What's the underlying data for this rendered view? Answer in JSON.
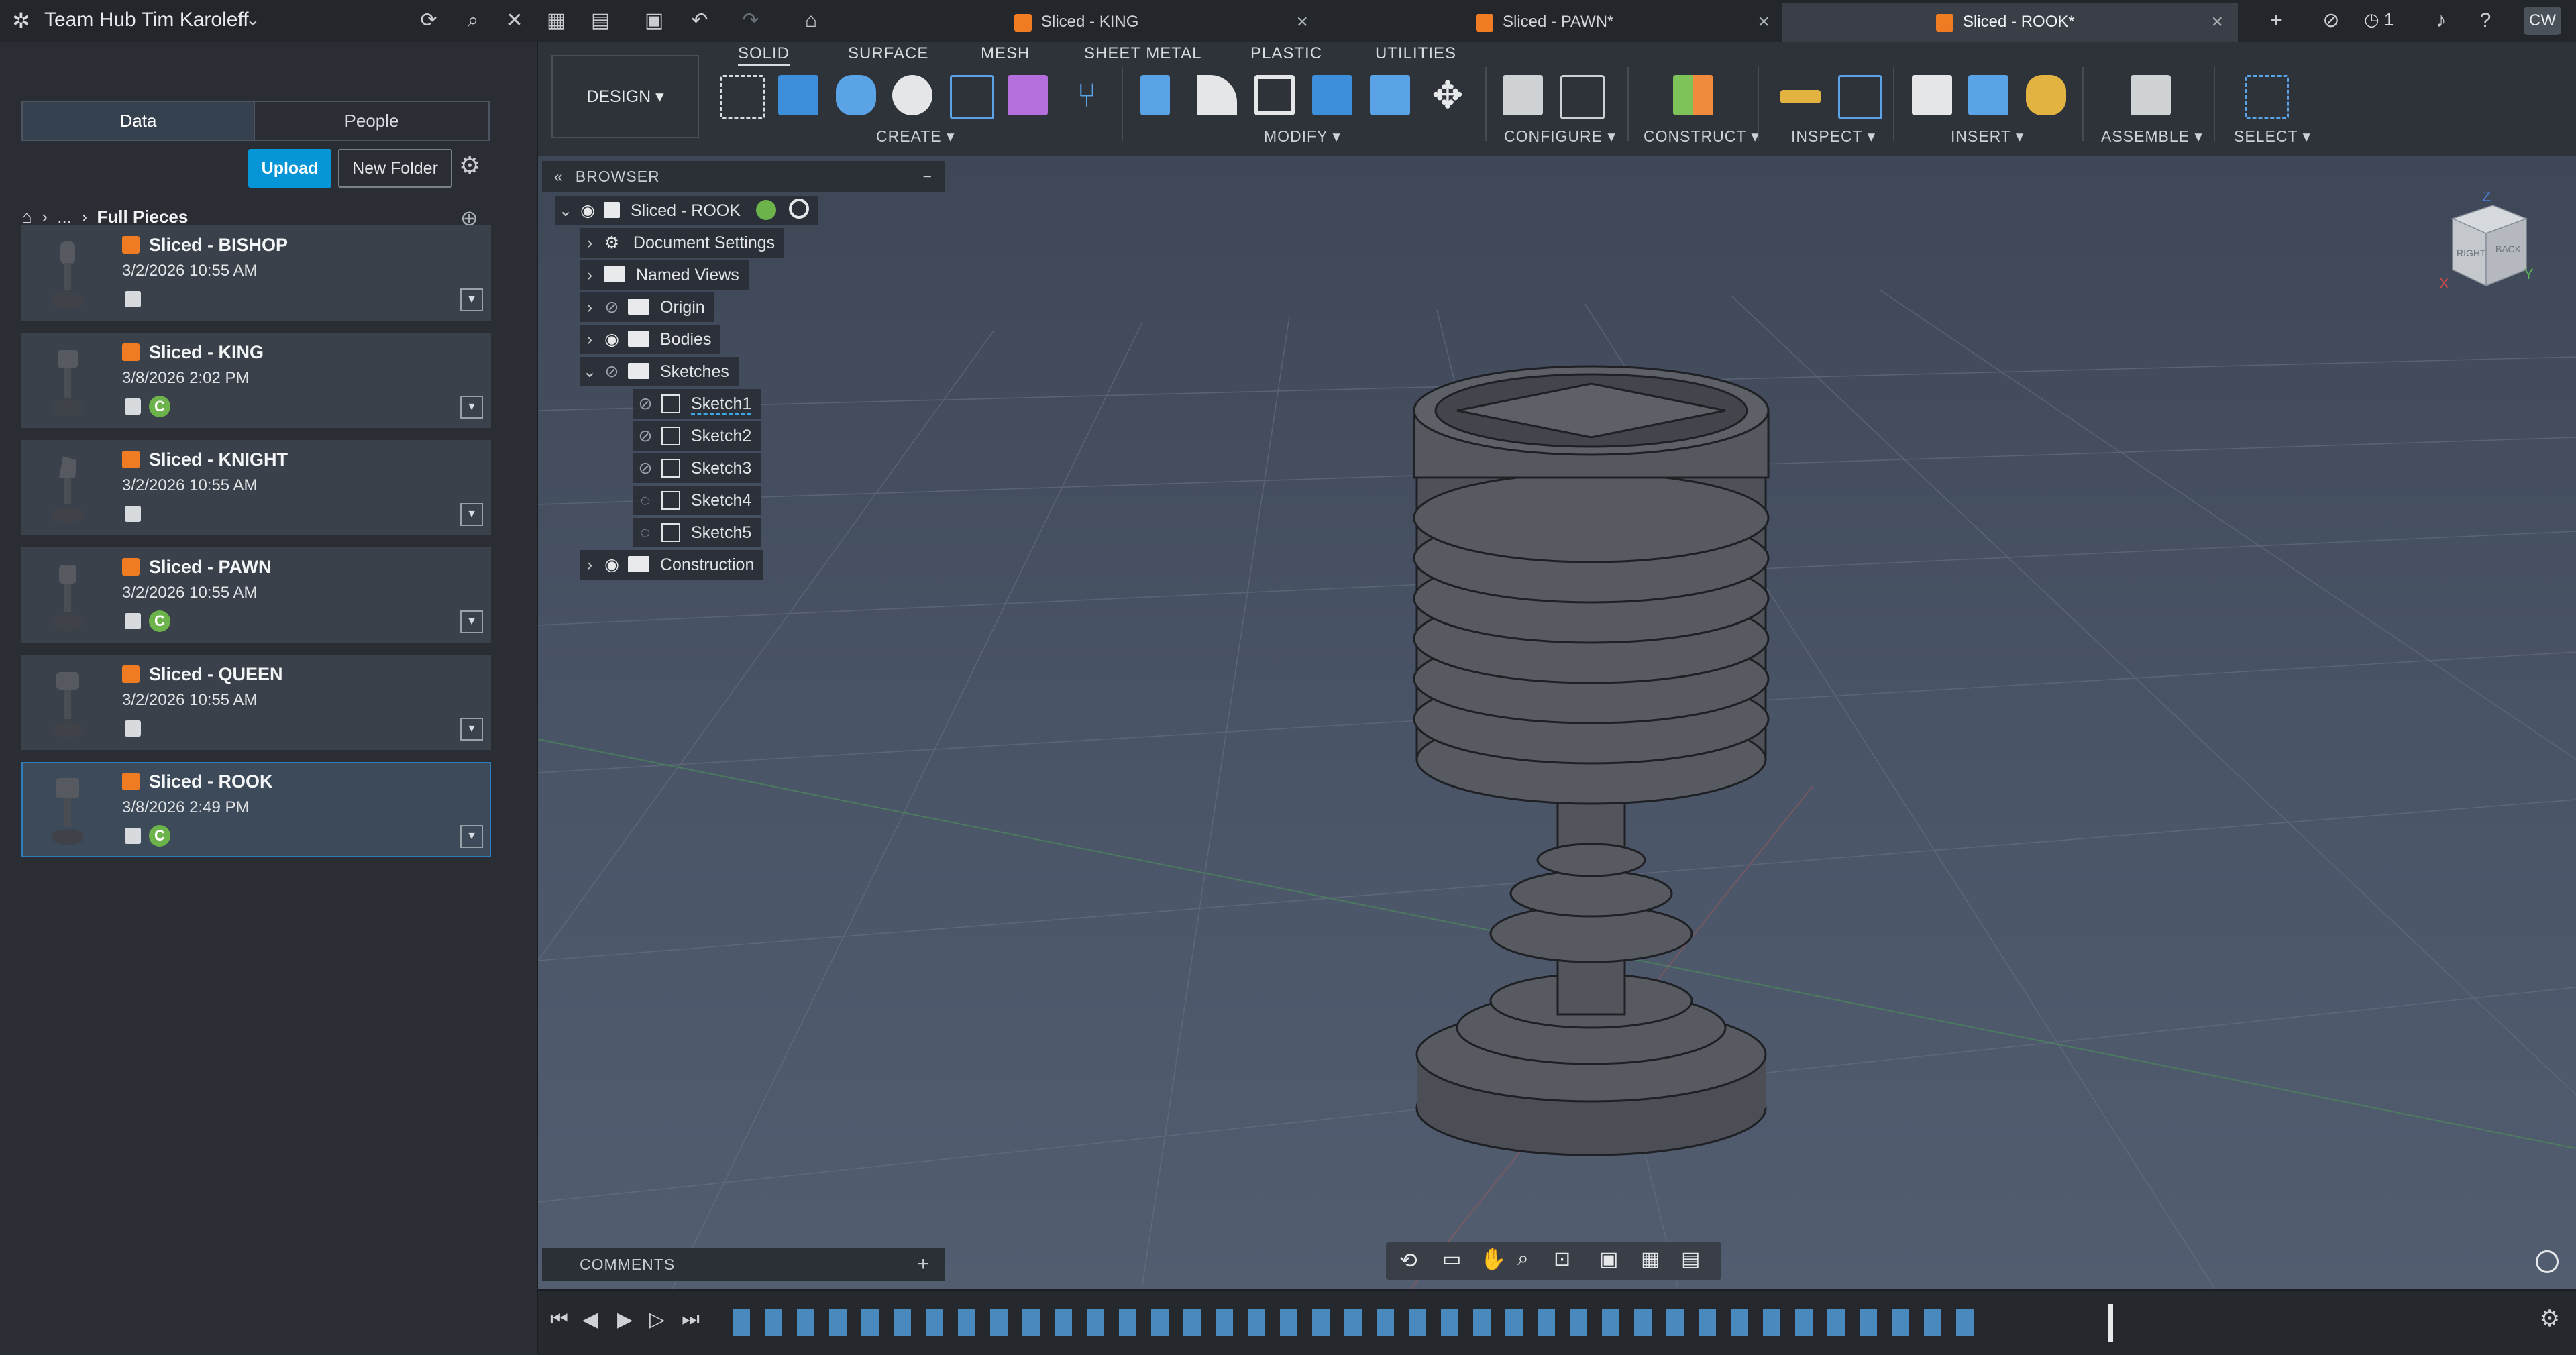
{
  "topbar": {
    "hub_title": "Team Hub Tim Karoleff",
    "user_initials": "CW",
    "notification_count": "1",
    "tabs": [
      {
        "label": "Sliced - KING"
      },
      {
        "label": "Sliced - PAWN*"
      },
      {
        "label": "Sliced - ROOK*"
      }
    ]
  },
  "data_panel": {
    "seg_data": "Data",
    "seg_people": "People",
    "upload": "Upload",
    "new_folder": "New Folder",
    "crumb_ellipsis": "...",
    "crumb_current": "Full Pieces",
    "files": [
      {
        "name": "Sliced - BISHOP",
        "date": "3/2/2026 10:55 AM",
        "badge": ""
      },
      {
        "name": "Sliced - KING",
        "date": "3/8/2026 2:02 PM",
        "badge": "C"
      },
      {
        "name": "Sliced - KNIGHT",
        "date": "3/2/2026 10:55 AM",
        "badge": ""
      },
      {
        "name": "Sliced - PAWN",
        "date": "3/2/2026 10:55 AM",
        "badge": "C"
      },
      {
        "name": "Sliced - QUEEN",
        "date": "3/2/2026 10:55 AM",
        "badge": ""
      },
      {
        "name": "Sliced - ROOK",
        "date": "3/8/2026 2:49 PM",
        "badge": "C"
      }
    ]
  },
  "toolbar": {
    "workspace": "DESIGN",
    "tabs": [
      "SOLID",
      "SURFACE",
      "MESH",
      "SHEET METAL",
      "PLASTIC",
      "UTILITIES"
    ],
    "groups": [
      "CREATE",
      "MODIFY",
      "CONFIGURE",
      "CONSTRUCT",
      "INSPECT",
      "INSERT",
      "ASSEMBLE",
      "SELECT"
    ]
  },
  "browser": {
    "title": "BROWSER",
    "root": "Sliced - ROOK",
    "items": {
      "document_settings": "Document Settings",
      "named_views": "Named Views",
      "origin": "Origin",
      "bodies": "Bodies",
      "sketches": "Sketches",
      "sketch1": "Sketch1",
      "sketch2": "Sketch2",
      "sketch3": "Sketch3",
      "sketch4": "Sketch4",
      "sketch5": "Sketch5",
      "construction": "Construction"
    }
  },
  "viewcube": {
    "right": "RIGHT",
    "back": "BACK",
    "axis_z": "Z",
    "axis_x": "X",
    "axis_y": "Y"
  },
  "comments": {
    "label": "COMMENTS"
  },
  "colors": {
    "accent": "#0696d7",
    "orange": "#ef7c22",
    "green_badge": "#6bb34a"
  }
}
